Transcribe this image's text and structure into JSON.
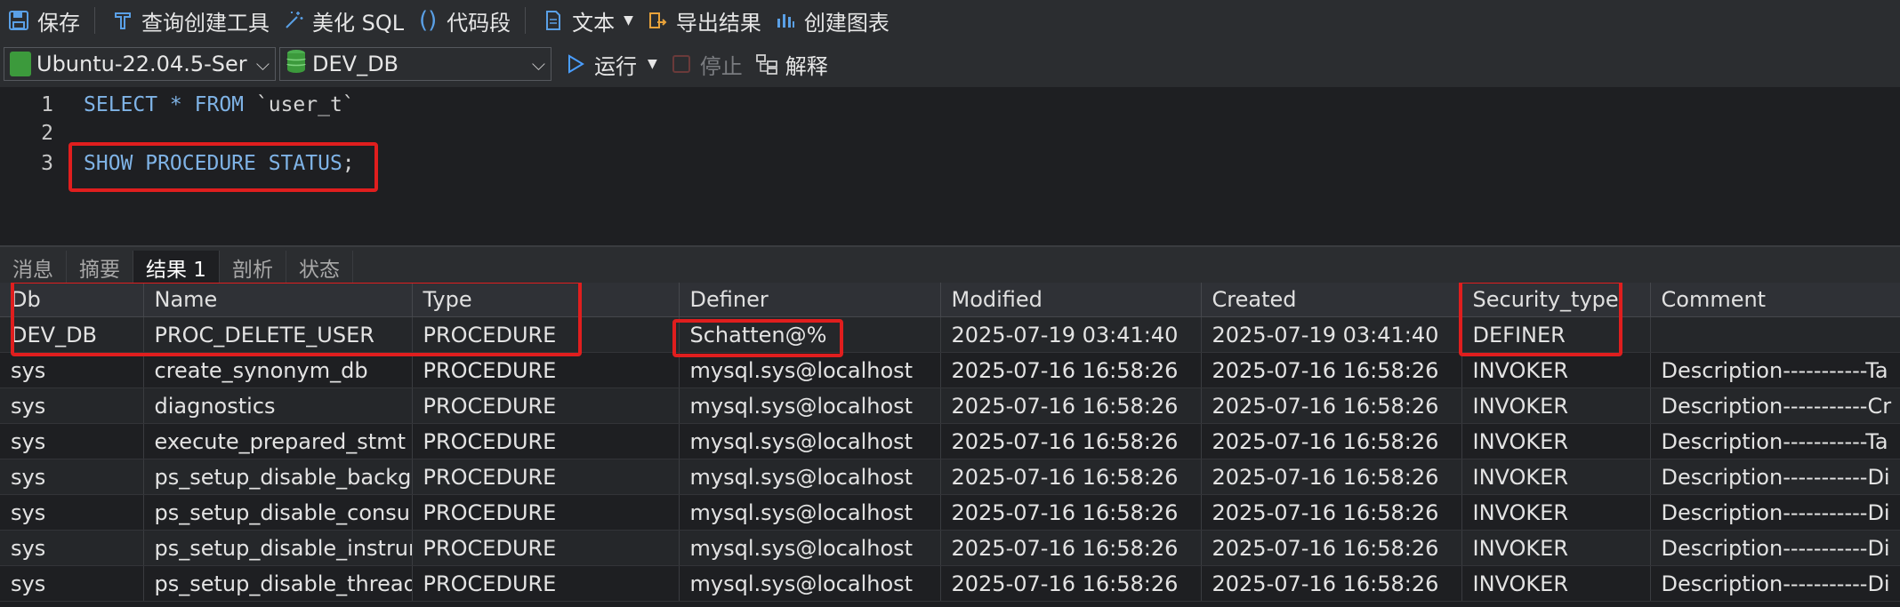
{
  "toolbar": {
    "save": "保存",
    "query_builder": "查询创建工具",
    "beautify": "美化 SQL",
    "snippet": "代码段",
    "text": "文本",
    "export": "导出结果",
    "create_chart": "创建图表"
  },
  "connection": {
    "server": "Ubuntu-22.04.5-Ser",
    "database": "DEV_DB",
    "run": "运行",
    "stop": "停止",
    "explain": "解释"
  },
  "editor": {
    "lines": [
      {
        "num": "1",
        "kw": "SELECT * FROM ",
        "rest": "`user_t`"
      },
      {
        "num": "2",
        "kw": "",
        "rest": ""
      },
      {
        "num": "3",
        "kw": "SHOW PROCEDURE STATUS",
        "rest": ";"
      }
    ]
  },
  "result_tabs": [
    "消息",
    "摘要",
    "结果 1",
    "剖析",
    "状态"
  ],
  "results": {
    "columns": [
      "Db",
      "Name",
      "Type",
      "Definer",
      "Modified",
      "Created",
      "Security_type",
      "Comment"
    ],
    "rows": [
      [
        "DEV_DB",
        "PROC_DELETE_USER",
        "PROCEDURE",
        "Schatten@%",
        "2025-07-19 03:41:40",
        "2025-07-19 03:41:40",
        "DEFINER",
        ""
      ],
      [
        "sys",
        "create_synonym_db",
        "PROCEDURE",
        "mysql.sys@localhost",
        "2025-07-16 16:58:26",
        "2025-07-16 16:58:26",
        "INVOKER",
        "Description-----------Ta"
      ],
      [
        "sys",
        "diagnostics",
        "PROCEDURE",
        "mysql.sys@localhost",
        "2025-07-16 16:58:26",
        "2025-07-16 16:58:26",
        "INVOKER",
        "Description-----------Cr"
      ],
      [
        "sys",
        "execute_prepared_stmt",
        "PROCEDURE",
        "mysql.sys@localhost",
        "2025-07-16 16:58:26",
        "2025-07-16 16:58:26",
        "INVOKER",
        "Description-----------Ta"
      ],
      [
        "sys",
        "ps_setup_disable_backgr",
        "PROCEDURE",
        "mysql.sys@localhost",
        "2025-07-16 16:58:26",
        "2025-07-16 16:58:26",
        "INVOKER",
        "Description-----------Di"
      ],
      [
        "sys",
        "ps_setup_disable_consun",
        "PROCEDURE",
        "mysql.sys@localhost",
        "2025-07-16 16:58:26",
        "2025-07-16 16:58:26",
        "INVOKER",
        "Description-----------Di"
      ],
      [
        "sys",
        "ps_setup_disable_instrun",
        "PROCEDURE",
        "mysql.sys@localhost",
        "2025-07-16 16:58:26",
        "2025-07-16 16:58:26",
        "INVOKER",
        "Description-----------Di"
      ],
      [
        "sys",
        "ps_setup_disable_thread",
        "PROCEDURE",
        "mysql.sys@localhost",
        "2025-07-16 16:58:26",
        "2025-07-16 16:58:26",
        "INVOKER",
        "Description-----------Di"
      ]
    ]
  },
  "colors": {
    "highlight": "#e01e1e",
    "keyword": "#7fb3e6",
    "run": "#4a9eff"
  }
}
